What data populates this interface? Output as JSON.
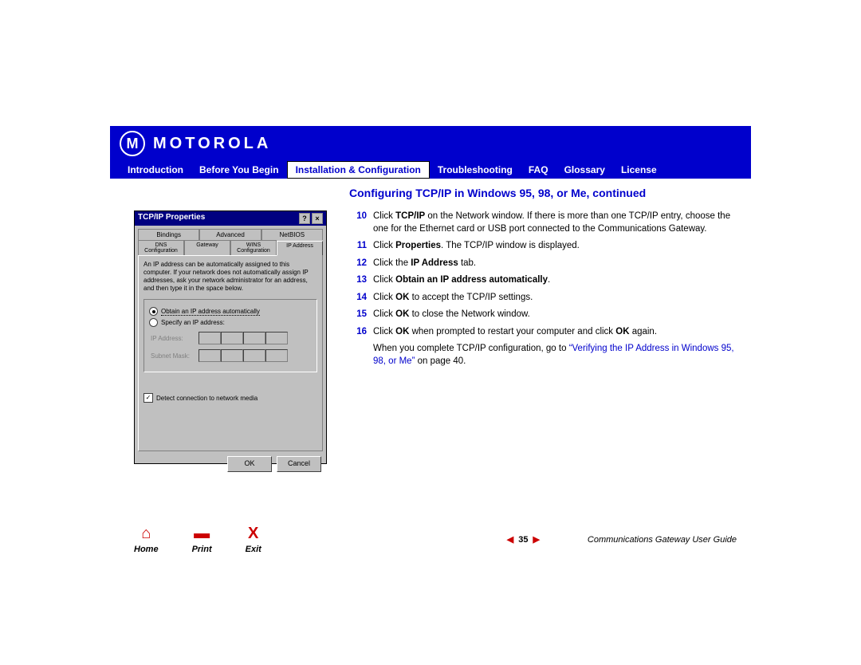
{
  "brand": "MOTOROLA",
  "nav": {
    "items": [
      "Introduction",
      "Before You Begin",
      "Installation & Configuration",
      "Troubleshooting",
      "FAQ",
      "Glossary",
      "License"
    ],
    "active": 2
  },
  "title": "Configuring TCP/IP in Windows 95, 98, or Me, continued",
  "dialog": {
    "title": "TCP/IP Properties",
    "tabs_top": [
      "Bindings",
      "Advanced",
      "NetBIOS"
    ],
    "tabs_bottom": [
      "DNS Configuration",
      "Gateway",
      "WINS Configuration",
      "IP Address"
    ],
    "desc": "An IP address can be automatically assigned to this computer. If your network does not automatically assign IP addresses, ask your network administrator for an address, and then type it in the space below.",
    "radio1": "Obtain an IP address automatically",
    "radio2": "Specify an IP address:",
    "fld1": "IP Address:",
    "fld2": "Subnet Mask:",
    "chk": "Detect connection to network media",
    "ok": "OK",
    "cancel": "Cancel"
  },
  "steps": [
    {
      "n": "10",
      "html": "Click <b>TCP/IP</b> on the Network window. If there is more than one TCP/IP entry, choose the one for the Ethernet card or USB port connected to the Communications Gateway."
    },
    {
      "n": "11",
      "html": "Click <b>Properties</b>. The TCP/IP window is displayed."
    },
    {
      "n": "12",
      "html": "Click the <b>IP Address</b> tab."
    },
    {
      "n": "13",
      "html": "Click <b>Obtain an IP address automatically</b>."
    },
    {
      "n": "14",
      "html": "Click <b>OK</b> to accept the TCP/IP settings."
    },
    {
      "n": "15",
      "html": "Click <b>OK</b> to close the Network window."
    },
    {
      "n": "16",
      "html": "Click <b>OK</b> when prompted to restart your computer and click <b>OK</b> again."
    }
  ],
  "after_pre": "When you complete TCP/IP configuration, go to ",
  "after_link": "“Verifying the IP Address in Windows  95, 98, or Me”",
  "after_post": " on page 40.",
  "footer": {
    "home": "Home",
    "print": "Print",
    "exit": "Exit",
    "page": "35",
    "guide": "Communications Gateway User Guide"
  }
}
